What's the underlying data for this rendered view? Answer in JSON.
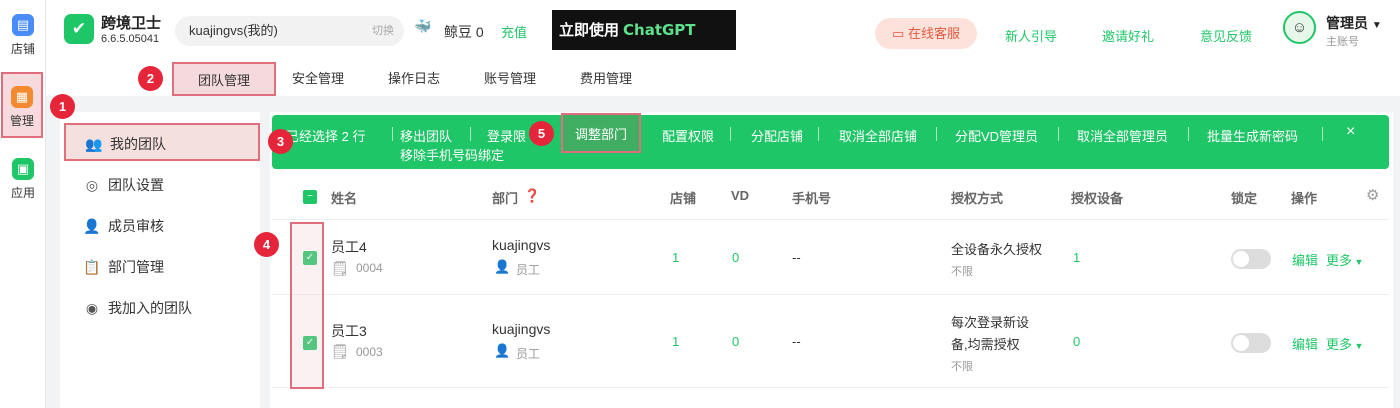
{
  "rail": {
    "items": [
      {
        "label": "店铺",
        "icon": "store-icon"
      },
      {
        "label": "管理",
        "icon": "manage-icon"
      },
      {
        "label": "应用",
        "icon": "apps-icon"
      }
    ]
  },
  "header": {
    "brand": "跨境卫士",
    "version": "6.6.5.05041",
    "account": "kuajingvs(我的)",
    "switch_label": "切换",
    "beans_label": "鲸豆 0",
    "recharge": "充值",
    "banner_text": "立即使用",
    "banner_gpt": "ChatGPT",
    "customer_service": "在线客服",
    "links": [
      "新人引导",
      "邀请好礼",
      "意见反馈"
    ],
    "user_name": "管理员",
    "user_role": "主账号"
  },
  "tabs": [
    "团队管理",
    "安全管理",
    "操作日志",
    "账号管理",
    "费用管理"
  ],
  "sidebar": {
    "items": [
      "我的团队",
      "团队设置",
      "成员审核",
      "部门管理",
      "我加入的团队"
    ]
  },
  "actionbar": {
    "selected": "已经选择 2 行",
    "actions": [
      "移出团队",
      "登录限",
      "调整部门",
      "配置权限",
      "分配店铺",
      "取消全部店铺",
      "分配VD管理员",
      "取消全部管理员",
      "批量生成新密码"
    ],
    "line2": "移除手机号码绑定",
    "close": "×"
  },
  "table": {
    "headers": [
      "姓名",
      "部门",
      "店铺",
      "VD",
      "手机号",
      "授权方式",
      "授权设备",
      "锁定",
      "操作"
    ],
    "rows": [
      {
        "name": "员工4",
        "id": "0004",
        "dept": "kuajingvs",
        "role": "员工",
        "shops": "1",
        "vd": "0",
        "phone": "--",
        "auth": "全设备永久授权",
        "auth2": "",
        "limit": "不限",
        "devices": "1",
        "edit": "编辑",
        "more": "更多"
      },
      {
        "name": "员工3",
        "id": "0003",
        "dept": "kuajingvs",
        "role": "员工",
        "shops": "1",
        "vd": "0",
        "phone": "--",
        "auth": "每次登录新设",
        "auth2": "备,均需授权",
        "limit": "不限",
        "devices": "0",
        "edit": "编辑",
        "more": "更多"
      }
    ]
  },
  "badges": [
    "1",
    "2",
    "3",
    "4",
    "5"
  ]
}
